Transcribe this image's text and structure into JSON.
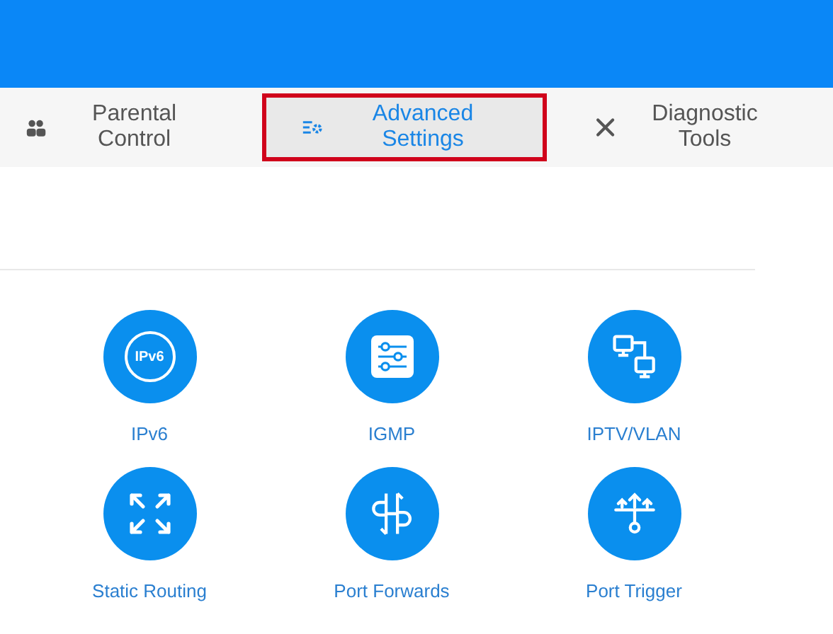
{
  "tabs": [
    {
      "label": "Parental Control",
      "selected": false
    },
    {
      "label": "Advanced Settings",
      "selected": true
    },
    {
      "label": "Diagnostic Tools",
      "selected": false
    }
  ],
  "features": [
    {
      "label": "IPv6",
      "badge": "IPv6"
    },
    {
      "label": "IGMP"
    },
    {
      "label": "IPTV/VLAN"
    },
    {
      "label": "Static Routing"
    },
    {
      "label": "Port Forwards"
    },
    {
      "label": "Port Trigger"
    }
  ]
}
